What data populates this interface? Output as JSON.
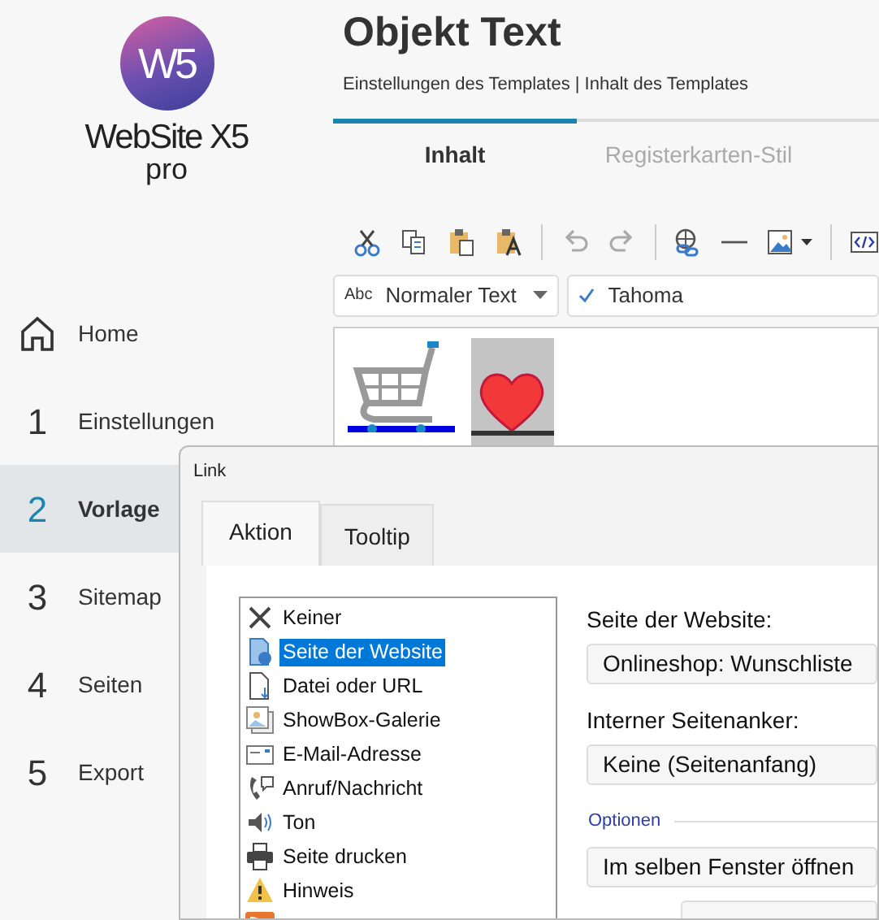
{
  "sidebar": {
    "logo": {
      "mark": "W5",
      "name": "WebSite X5",
      "edition": "pro"
    },
    "items": [
      {
        "kind": "home",
        "label": "Home",
        "selected": false
      },
      {
        "kind": "step",
        "number": "1",
        "label": "Einstellungen",
        "selected": false
      },
      {
        "kind": "step",
        "number": "2",
        "label": "Vorlage",
        "selected": true
      },
      {
        "kind": "step",
        "number": "3",
        "label": "Sitemap",
        "selected": false
      },
      {
        "kind": "step",
        "number": "4",
        "label": "Seiten",
        "selected": false
      },
      {
        "kind": "step",
        "number": "5",
        "label": "Export",
        "selected": false
      }
    ]
  },
  "header": {
    "title": "Objekt Text",
    "breadcrumb": "Einstellungen des Templates | Inhalt des Templates"
  },
  "tabs": [
    {
      "label": "Inhalt",
      "selected": true
    },
    {
      "label": "Registerkarten-Stil",
      "selected": false
    }
  ],
  "format_bar": {
    "style_prefix": "Abc",
    "style": "Normaler Text",
    "font": "Tahoma"
  },
  "dialog": {
    "title": "Link",
    "tabs": [
      {
        "label": "Aktion",
        "selected": true
      },
      {
        "label": "Tooltip",
        "selected": false
      }
    ],
    "actions": [
      {
        "kind": "none",
        "label": "Keiner",
        "selected": false
      },
      {
        "kind": "page",
        "label": "Seite der Website",
        "selected": true
      },
      {
        "kind": "file",
        "label": "Datei oder URL",
        "selected": false
      },
      {
        "kind": "gallery",
        "label": "ShowBox-Galerie",
        "selected": false
      },
      {
        "kind": "mail",
        "label": "E-Mail-Adresse",
        "selected": false
      },
      {
        "kind": "phone",
        "label": "Anruf/Nachricht",
        "selected": false
      },
      {
        "kind": "sound",
        "label": "Ton",
        "selected": false
      },
      {
        "kind": "print",
        "label": "Seite drucken",
        "selected": false
      },
      {
        "kind": "notice",
        "label": "Hinweis",
        "selected": false
      }
    ],
    "fields": [
      {
        "kind": "label",
        "text": "Seite der Website:"
      },
      {
        "kind": "select",
        "value": "Onlineshop: Wunschliste"
      },
      {
        "kind": "label",
        "text": "Interner Seitenanker:"
      },
      {
        "kind": "select",
        "value": "Keine (Seitenanfang)"
      },
      {
        "kind": "section",
        "text": "Optionen"
      },
      {
        "kind": "select",
        "value": "Im selben Fenster öffnen"
      }
    ]
  }
}
